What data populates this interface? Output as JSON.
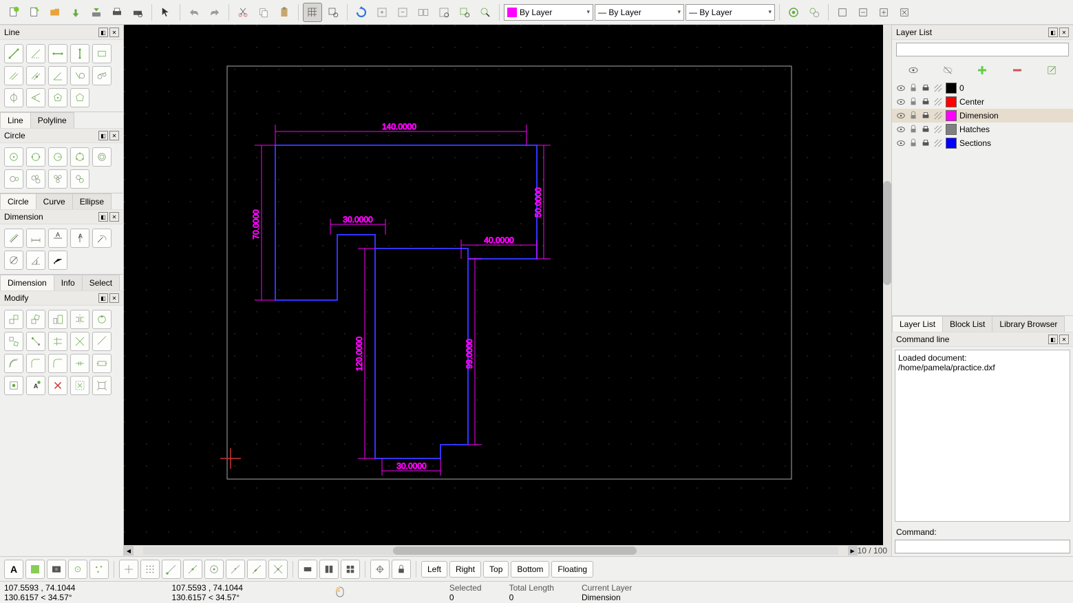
{
  "toolbar": {
    "color_combo": "By Layer",
    "linewidth_combo": "— By Layer",
    "linetype_combo": "— By Layer"
  },
  "left": {
    "line_title": "Line",
    "line_tabs": [
      "Line",
      "Polyline"
    ],
    "circle_title": "Circle",
    "circle_tabs": [
      "Circle",
      "Curve",
      "Ellipse"
    ],
    "dimension_title": "Dimension",
    "dimension_tabs": [
      "Dimension",
      "Info",
      "Select"
    ],
    "modify_title": "Modify"
  },
  "canvas": {
    "dimensions": {
      "top": "140.0000",
      "left": "70.0000",
      "inner_top": "30.0000",
      "right_short": "50.0000",
      "right_notch": "40.0000",
      "mid_left_v": "120.0000",
      "mid_right_v": "99.0000",
      "bottom": "30.0000"
    }
  },
  "right": {
    "layerlist_title": "Layer List",
    "layers": [
      {
        "name": "0",
        "color": "#000000"
      },
      {
        "name": "Center",
        "color": "#ff0000"
      },
      {
        "name": "Dimension",
        "color": "#ff00ff",
        "selected": true
      },
      {
        "name": "Hatches",
        "color": "#808080"
      },
      {
        "name": "Sections",
        "color": "#0000ff"
      }
    ],
    "right_tabs": [
      "Layer List",
      "Block List",
      "Library Browser"
    ],
    "cmd_title": "Command line",
    "cmd_log1": "Loaded document:",
    "cmd_log2": "/home/pamela/practice.dxf",
    "cmd_label": "Command:"
  },
  "bottom": {
    "dock": [
      "Left",
      "Right",
      "Top",
      "Bottom",
      "Floating"
    ],
    "zoom": "10 / 100"
  },
  "status": {
    "abs_coord": "107.5593 , 74.1044",
    "polar_coord": "130.6157 < 34.57°",
    "abs_coord2": "107.5593 , 74.1044",
    "polar_coord2": "130.6157 < 34.57°",
    "selected_label": "Selected",
    "selected_val": "0",
    "totlen_label": "Total Length",
    "totlen_val": "0",
    "curlayer_label": "Current Layer",
    "curlayer_val": "Dimension"
  }
}
